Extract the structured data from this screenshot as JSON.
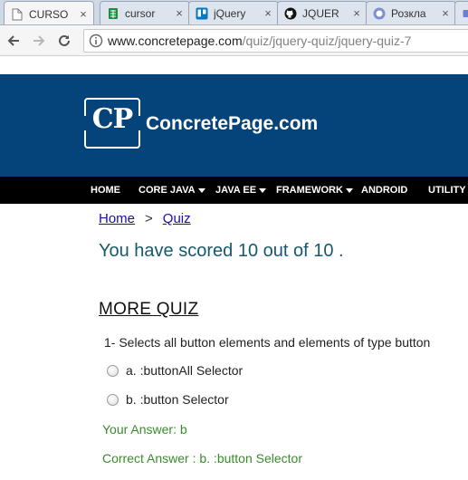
{
  "browser": {
    "tabs": [
      {
        "title": "CURSO",
        "icon": "document-icon"
      },
      {
        "title": "cursor",
        "icon": "spreadsheet-icon"
      },
      {
        "title": "jQuery",
        "icon": "trello-icon"
      },
      {
        "title": "JQUER",
        "icon": "github-icon"
      },
      {
        "title": "Розкла",
        "icon": "calendar-icon"
      }
    ],
    "close_label": "×",
    "url": {
      "host": "www.concretepage.com",
      "path": "/quiz/jquery-quiz/jquery-quiz-7"
    }
  },
  "site": {
    "logo_text": "CP",
    "name": "ConcretePage.com",
    "header_color": "#05447a"
  },
  "nav": {
    "items": [
      {
        "label": "HOME",
        "dropdown": false
      },
      {
        "label": "CORE JAVA",
        "dropdown": true
      },
      {
        "label": "JAVA EE",
        "dropdown": true
      },
      {
        "label": "FRAMEWORK",
        "dropdown": true
      },
      {
        "label": "ANDROID",
        "dropdown": false
      },
      {
        "label": "UTILITY",
        "dropdown": false
      }
    ]
  },
  "breadcrumb": {
    "home": "Home",
    "separator": ">",
    "current": "Quiz"
  },
  "score_text": "You have scored 10 out of 10 .",
  "more_quiz_heading": "MORE QUIZ",
  "question": {
    "text": "1- Selects all button elements and elements of type button",
    "options": [
      {
        "label": "a. :buttonAll Selector",
        "checked": false
      },
      {
        "label": "b. :button Selector",
        "checked": false
      }
    ],
    "your_answer": "Your Answer: b",
    "correct_answer": "Correct Answer : b. :button Selector"
  }
}
